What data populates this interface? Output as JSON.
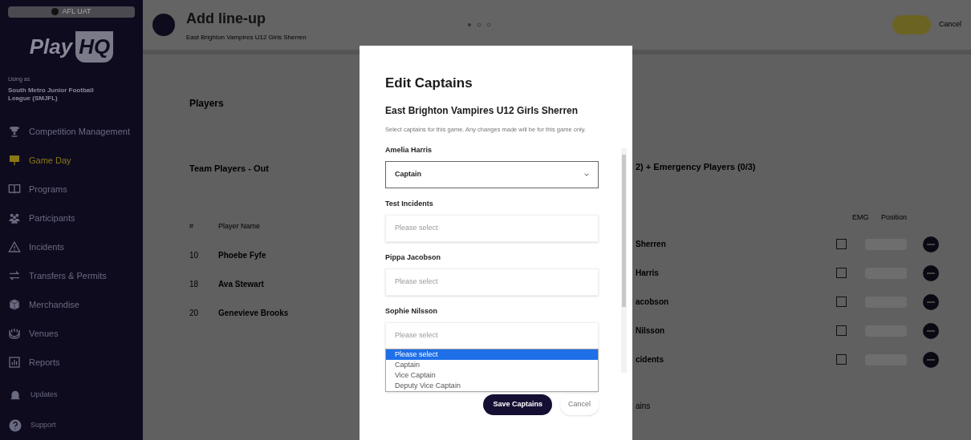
{
  "sidebar": {
    "environment": "AFL UAT",
    "logo": {
      "part_1": "Play",
      "part_2": "HQ"
    },
    "using_as": "Using as",
    "organisation": "South Metro Junior Football League (SMJFL)",
    "items": [
      {
        "label": "Competition Management",
        "selected": false
      },
      {
        "label": "Game Day",
        "selected": true
      },
      {
        "label": "Programs",
        "selected": false
      },
      {
        "label": "Participants",
        "selected": false
      },
      {
        "label": "Incidents",
        "selected": false
      },
      {
        "label": "Transfers & Permits",
        "selected": false
      },
      {
        "label": "Merchandise",
        "selected": false
      },
      {
        "label": "Venues",
        "selected": false
      },
      {
        "label": "Reports",
        "selected": false
      }
    ],
    "footer": [
      {
        "label": "Updates"
      },
      {
        "label": "Support"
      }
    ]
  },
  "header": {
    "title": "Add line-up",
    "subtitle": "East Brighton Vampires U12 Girls Sherren",
    "cancel": "Cancel"
  },
  "players": {
    "title": "Players"
  },
  "team_out": {
    "title": "Team Players - Out",
    "columns": [
      "#",
      "Player Name"
    ],
    "rows": [
      {
        "number": "10",
        "name": "Phoebe Fyfe"
      },
      {
        "number": "18",
        "name": "Ava Stewart"
      },
      {
        "number": "20",
        "name": "Genevieve Brooks"
      }
    ]
  },
  "team_in": {
    "title": "2) + Emergency Players (0/3)",
    "columns": [
      "EMG",
      "Position"
    ],
    "rows": [
      {
        "name": "Sherren",
        "emg": false
      },
      {
        "name": "Harris",
        "emg": false
      },
      {
        "name": "acobson",
        "emg": false
      },
      {
        "name": "Nilsson",
        "emg": false
      },
      {
        "name": "cidents",
        "emg": false
      }
    ],
    "footer_text": "ains"
  },
  "modal": {
    "title": "Edit Captains",
    "subtitle": "East Brighton Vampires U12 Girls Sherren",
    "description": "Select captains for this game. Any changes made will be for this game only.",
    "fields": [
      {
        "label": "Amelia Harris",
        "value": "Captain",
        "focused": true
      },
      {
        "label": "Test Incidents",
        "placeholder": "Please select",
        "focused": false
      },
      {
        "label": "Pippa Jacobson",
        "placeholder": "Please select",
        "focused": false
      },
      {
        "label": "Sophie Nilsson",
        "placeholder": "Please select",
        "focused": false,
        "options": [
          {
            "label": "Please select",
            "selected": true
          },
          {
            "label": "Captain",
            "selected": false
          },
          {
            "label": "Vice Captain",
            "selected": false
          },
          {
            "label": "Deputy Vice Captain",
            "selected": false
          }
        ]
      }
    ],
    "save": "Save Captains",
    "cancel": "Cancel"
  }
}
